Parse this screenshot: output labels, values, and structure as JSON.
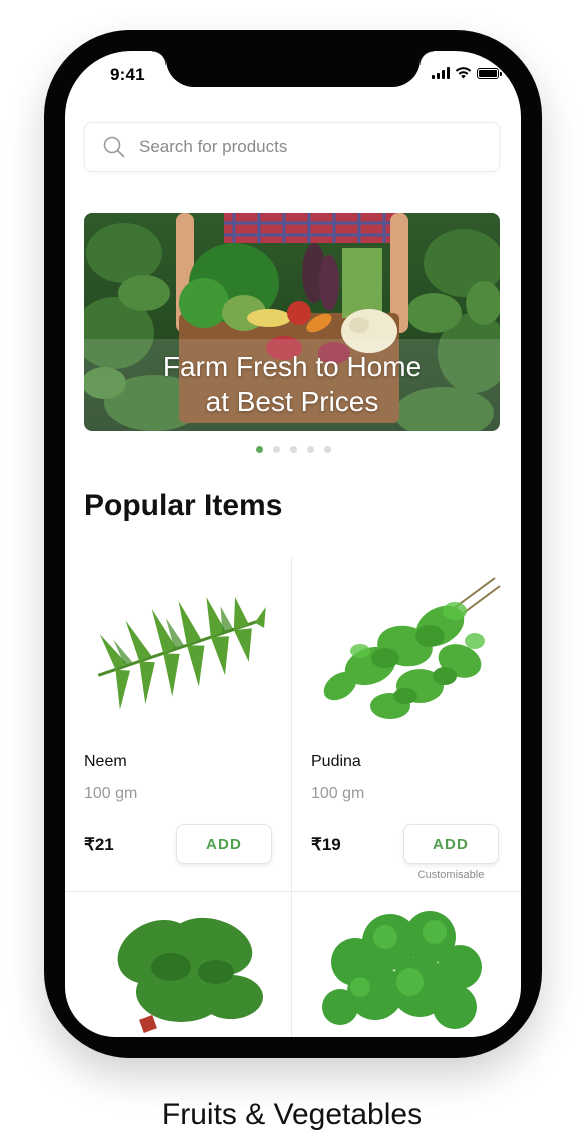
{
  "status_bar": {
    "time": "9:41"
  },
  "search": {
    "placeholder": "Search for products",
    "icon": "search-icon"
  },
  "banner": {
    "line1": "Farm Fresh to Home",
    "line2": "at Best Prices",
    "slides_count": 5,
    "active_slide": 1
  },
  "section": {
    "title": "Popular Items"
  },
  "products": [
    {
      "name": "Neem",
      "quantity": "100 gm",
      "price": "₹21",
      "button": "ADD",
      "note": ""
    },
    {
      "name": "Pudina",
      "quantity": "100 gm",
      "price": "₹19",
      "button": "ADD",
      "note": "Customisable"
    }
  ],
  "caption": "Fruits & Vegetables",
  "colors": {
    "accent": "#5ea85a",
    "button_text": "#4f9f4c"
  }
}
